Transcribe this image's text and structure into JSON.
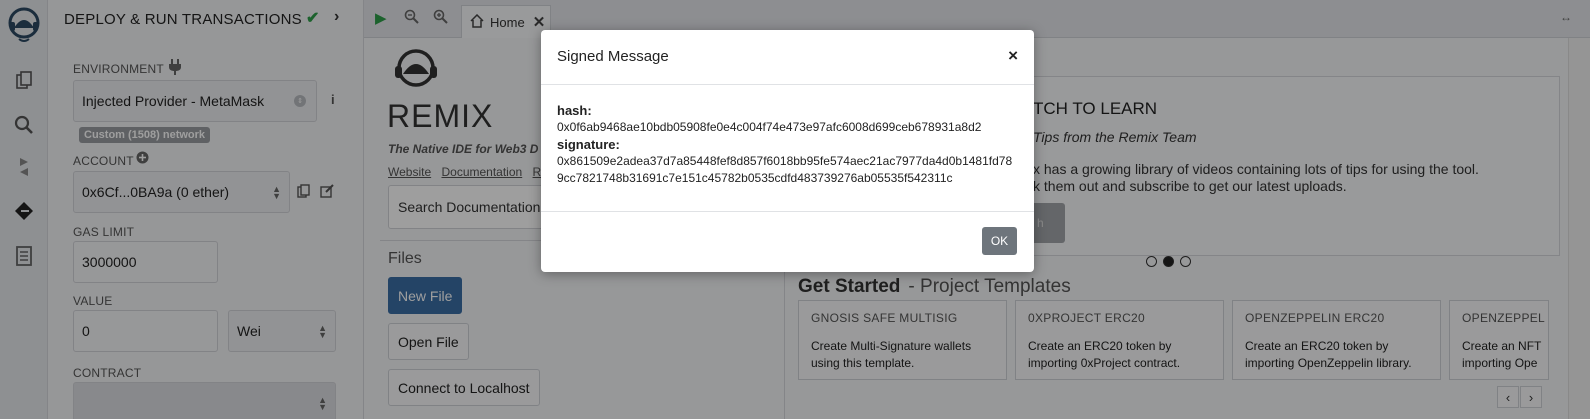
{
  "panel": {
    "title": "DEPLOY & RUN TRANSACTIONS",
    "environment_label": "ENVIRONMENT",
    "environment_value": "Injected Provider - MetaMask",
    "network_badge": "Custom (1508) network",
    "account_label": "ACCOUNT",
    "account_value": "0x6Cf...0BA9a (0 ether)",
    "gas_label": "GAS LIMIT",
    "gas_value": "3000000",
    "value_label": "VALUE",
    "value_amount": "0",
    "value_unit": "Wei",
    "contract_label": "CONTRACT"
  },
  "tabs": [
    {
      "label": "Home"
    }
  ],
  "home": {
    "title": "REMIX",
    "subtitle": "The Native IDE for Web3 D",
    "links": [
      "Website",
      "Documentation",
      "R"
    ],
    "search_label": "Search Documentation",
    "files_heading": "Files",
    "new_file": "New File",
    "open_file": "Open File",
    "connect_localhost": "Connect to Localhost",
    "learn_title": "TCH TO LEARN",
    "learn_subtitle": "Tips from the Remix Team",
    "learn_body_1": "x has a growing library of videos containing lots of tips for using the tool.",
    "learn_body_2": "k them out and subscribe to get our latest uploads.",
    "learn_button": "h",
    "get_started": "Get Started",
    "get_started_sub": "- Project Templates",
    "cards": [
      {
        "title": "GNOSIS SAFE MULTISIG",
        "desc": "Create Multi-Signature wallets using this template."
      },
      {
        "title": "0XPROJECT ERC20",
        "desc": "Create an ERC20 token by importing 0xProject contract."
      },
      {
        "title": "OPENZEPPELIN ERC20",
        "desc": "Create an ERC20 token by importing OpenZeppelin library."
      },
      {
        "title": "OPENZEPPEL",
        "desc": "Create an NFT importing Ope"
      }
    ],
    "carousel": {
      "count": 3,
      "active": 1
    }
  },
  "modal": {
    "title": "Signed Message",
    "close": "×",
    "hash_label": "hash:",
    "hash_value": "0x0f6ab9468ae10bdb05908fe0e4c004f74e473e97afc6008d699ceb678931a8d2",
    "signature_label": "signature:",
    "signature_value": "0x861509e2adea37d7a85448fef8d857f6018bb95fe574aec21ac7977da4d0b1481fd789cc7821748b31691c7e151c45782b0535cdfd483739276ab05535f542311c",
    "ok": "OK"
  },
  "colors": {
    "accent": "#3b6ea5",
    "check": "#2e9e4a",
    "ok_button": "#6e757c"
  }
}
